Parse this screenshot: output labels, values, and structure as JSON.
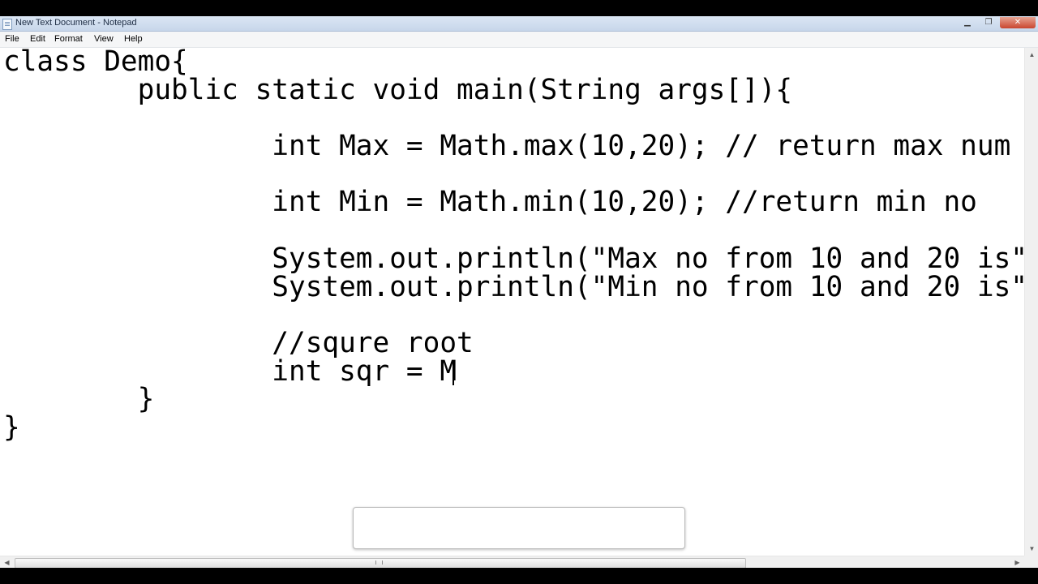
{
  "window": {
    "title": "New Text Document - Notepad",
    "minimize_glyph": "▁",
    "maximize_glyph": "❐",
    "close_glyph": "✕"
  },
  "menu": {
    "items": [
      "File",
      "Edit",
      "Format",
      "View",
      "Help"
    ]
  },
  "editor": {
    "lines": [
      "class Demo{",
      "        public static void main(String args[]){",
      "",
      "                int Max = Math.max(10,20); // return max num",
      "",
      "                int Min = Math.min(10,20); //return min no",
      "",
      "                System.out.println(\"Max no from 10 and 20 is\"",
      "                System.out.println(\"Min no from 10 and 20 is\"",
      "",
      "                //squre root",
      "                int sqr = M",
      "        }",
      "}"
    ]
  },
  "scrollbars": {
    "up_arrow": "▲",
    "down_arrow": "▼",
    "left_arrow": "◀",
    "right_arrow": "▶"
  },
  "icons": {
    "app": "notepad-icon",
    "minimize": "minimize-icon",
    "maximize": "maximize-icon",
    "close": "close-icon"
  },
  "colors": {
    "titlebar": "#dbe6f4",
    "close_button": "#c9452f",
    "text": "#000000"
  }
}
